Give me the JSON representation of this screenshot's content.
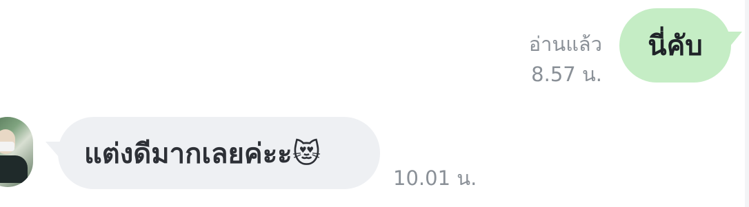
{
  "chat": {
    "outgoing_message": {
      "text": "นี่คับ",
      "read_status": "อ่านแล้ว",
      "time": "8.57 น."
    },
    "incoming_message": {
      "text": "แต่งดีมากเลยค่ะะ😻",
      "time": "10.01 น."
    }
  },
  "colors": {
    "outgoing_bubble": "#c5edc5",
    "incoming_bubble": "#eef0f3",
    "meta_text": "#8a9097"
  }
}
